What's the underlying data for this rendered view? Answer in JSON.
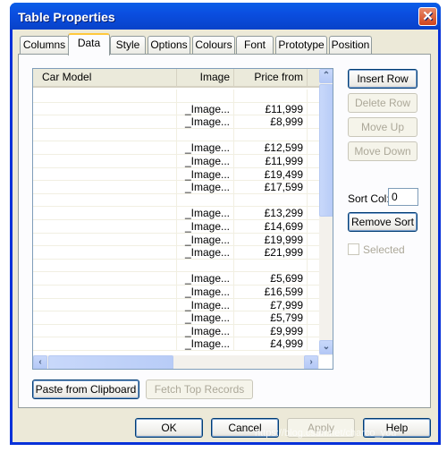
{
  "window": {
    "title": "Table Properties",
    "close_icon": "close-icon"
  },
  "tabs": [
    {
      "label": "Columns"
    },
    {
      "label": "Data",
      "active": true
    },
    {
      "label": "Style"
    },
    {
      "label": "Options"
    },
    {
      "label": "Colours"
    },
    {
      "label": "Font"
    },
    {
      "label": "Prototype"
    },
    {
      "label": "Position"
    }
  ],
  "grid": {
    "columns": [
      "Car Model",
      "Image",
      "Price from"
    ],
    "rows": [
      [
        "",
        "",
        ""
      ],
      [
        "",
        "_Image...",
        "£11,999"
      ],
      [
        "",
        "_Image...",
        "£8,999"
      ],
      [
        "",
        "",
        ""
      ],
      [
        "",
        "_Image...",
        "£12,599"
      ],
      [
        "",
        "_Image...",
        "£11,999"
      ],
      [
        "",
        "_Image...",
        "£19,499"
      ],
      [
        "",
        "_Image...",
        "£17,599"
      ],
      [
        "",
        "",
        ""
      ],
      [
        "",
        "_Image...",
        "£13,299"
      ],
      [
        "",
        "_Image...",
        "£14,699"
      ],
      [
        "",
        "_Image...",
        "£19,999"
      ],
      [
        "",
        "_Image...",
        "£21,999"
      ],
      [
        "",
        "",
        ""
      ],
      [
        "",
        "_Image...",
        "£5,699"
      ],
      [
        "",
        "_Image...",
        "£16,599"
      ],
      [
        "",
        "_Image...",
        "£7,999"
      ],
      [
        "",
        "_Image...",
        "£5,799"
      ],
      [
        "",
        "_Image...",
        "£9,999"
      ],
      [
        "",
        "_Image...",
        "£4,999"
      ]
    ]
  },
  "side": {
    "insert_row": "Insert Row",
    "delete_row": "Delete Row",
    "move_up": "Move Up",
    "move_down": "Move Down",
    "sort_col_label": "Sort Col:",
    "sort_col_value": "0",
    "remove_sort": "Remove Sort",
    "selected_label": "Selected",
    "selected_checked": false
  },
  "bottom": {
    "paste": "Paste from Clipboard",
    "fetch": "Fetch Top Records"
  },
  "footer": {
    "ok": "OK",
    "cancel": "Cancel",
    "apply": "Apply",
    "help": "Help"
  },
  "watermark": "https://blog.csdn.net/charco_you"
}
